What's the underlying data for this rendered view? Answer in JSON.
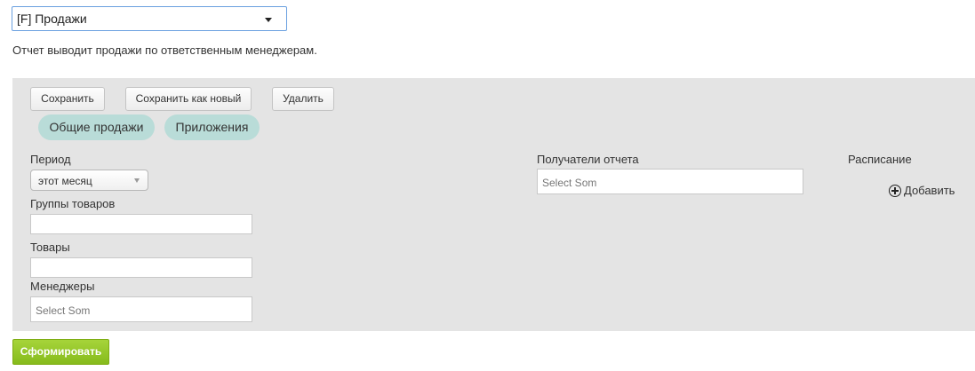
{
  "report_selector": {
    "value": "[F] Продажи"
  },
  "description": "Отчет выводит продажи по ответственным менеджерам.",
  "toolbar": {
    "save_label": "Сохранить",
    "save_as_new_label": "Сохранить как новый",
    "delete_label": "Удалить"
  },
  "tabs": [
    {
      "label": "Общие продажи"
    },
    {
      "label": "Приложения"
    }
  ],
  "filters": {
    "period": {
      "label": "Период",
      "value": "этот месяц"
    },
    "product_groups": {
      "label": "Группы товаров",
      "value": ""
    },
    "products": {
      "label": "Товары",
      "value": ""
    },
    "managers": {
      "label": "Менеджеры",
      "placeholder": "Select Som"
    }
  },
  "recipients": {
    "label": "Получатели отчета",
    "placeholder": "Select Som"
  },
  "schedule": {
    "label": "Расписание",
    "add_label": "Добавить"
  },
  "generate_label": "Сформировать",
  "colors": {
    "accent_green": "#8fc22a",
    "tab_bg": "#b9dcd8",
    "panel_bg": "#e4e4e4",
    "focus_border": "#6aa0e0"
  }
}
